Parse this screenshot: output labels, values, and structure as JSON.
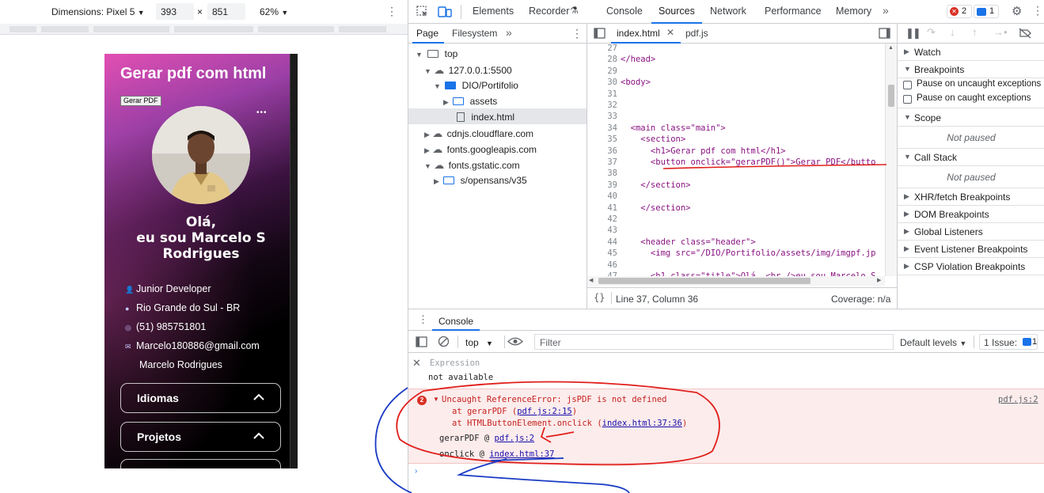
{
  "device_toolbar": {
    "dimensions_label": "Dimensions: Pixel 5",
    "width": "393",
    "times": "×",
    "height": "851",
    "zoom": "62%"
  },
  "phone": {
    "title": "Gerar pdf com html",
    "gerar_button": "Gerar PDF",
    "more": "•••",
    "greeting_line1": "Olá,",
    "greeting_line2": "eu sou Marcelo S",
    "greeting_line3": "Rodrigues",
    "info": [
      {
        "icon": "person-icon",
        "text": "Junior Developer"
      },
      {
        "icon": "location-icon",
        "text": "Rio Grande do Sul - BR"
      },
      {
        "icon": "whatsapp-icon",
        "text": "(51) 985751801"
      },
      {
        "icon": "mail-icon",
        "text": "Marcelo180886@gmail.com"
      },
      {
        "icon": "",
        "text": "Marcelo Rodrigues"
      }
    ],
    "accordions": [
      {
        "label": "Idiomas"
      },
      {
        "label": "Projetos"
      }
    ]
  },
  "devtools": {
    "tabs": [
      "Elements",
      "Recorder",
      "Console",
      "Sources",
      "Network",
      "Performance",
      "Memory"
    ],
    "active_tab": "Sources",
    "error_count": "2",
    "message_count": "1",
    "nav_tabs": [
      "Page",
      "Filesystem"
    ],
    "tree": [
      {
        "label": "top",
        "type": "frame"
      },
      {
        "label": "127.0.0.1:5500",
        "type": "cloud"
      },
      {
        "label": "DIO/Portifolio",
        "type": "folder"
      },
      {
        "label": "assets",
        "type": "folder"
      },
      {
        "label": "index.html",
        "type": "file"
      },
      {
        "label": "cdnjs.cloudflare.com",
        "type": "cloud"
      },
      {
        "label": "fonts.googleapis.com",
        "type": "cloud"
      },
      {
        "label": "fonts.gstatic.com",
        "type": "cloud"
      },
      {
        "label": "s/opensans/v35",
        "type": "folder"
      }
    ],
    "editor_tabs": [
      "index.html",
      "pdf.js"
    ],
    "code_lines": [
      {
        "n": "27",
        "t": ""
      },
      {
        "n": "28",
        "t": "</head>"
      },
      {
        "n": "29",
        "t": ""
      },
      {
        "n": "30",
        "t": "<body>"
      },
      {
        "n": "31",
        "t": ""
      },
      {
        "n": "32",
        "t": ""
      },
      {
        "n": "33",
        "t": ""
      },
      {
        "n": "34",
        "t": "  <main class=\"main\">"
      },
      {
        "n": "35",
        "t": "    <section>"
      },
      {
        "n": "36",
        "t": "      <h1>Gerar pdf com html</h1>"
      },
      {
        "n": "37",
        "t": "      <button onclick=\"gerarPDF()\">Gerar PDF</butto"
      },
      {
        "n": "38",
        "t": ""
      },
      {
        "n": "39",
        "t": "    </section>"
      },
      {
        "n": "40",
        "t": ""
      },
      {
        "n": "41",
        "t": "    </section>"
      },
      {
        "n": "42",
        "t": ""
      },
      {
        "n": "43",
        "t": ""
      },
      {
        "n": "44",
        "t": "    <header class=\"header\">"
      },
      {
        "n": "45",
        "t": "      <img src=\"/DIO/Portifolio/assets/img/imgpf.jp"
      },
      {
        "n": "46",
        "t": ""
      },
      {
        "n": "47",
        "t": "      <h1 class=\"title\">Olá, <br />eu sou Marcelo S"
      }
    ],
    "status_position": "Line 37, Column 36",
    "status_coverage": "Coverage: n/a",
    "right_sections": [
      {
        "label": "Watch",
        "open": false
      },
      {
        "label": "Breakpoints",
        "open": true
      },
      {
        "label": "Scope",
        "open": true
      },
      {
        "label": "Call Stack",
        "open": true
      },
      {
        "label": "XHR/fetch Breakpoints",
        "open": false
      },
      {
        "label": "DOM Breakpoints",
        "open": false
      },
      {
        "label": "Global Listeners",
        "open": false
      },
      {
        "label": "Event Listener Breakpoints",
        "open": false
      },
      {
        "label": "CSP Violation Breakpoints",
        "open": false
      }
    ],
    "pause_uncaught": "Pause on uncaught exceptions",
    "pause_caught": "Pause on caught exceptions",
    "not_paused": "Not paused",
    "console": {
      "tab_label": "Console",
      "context": "top",
      "filter_placeholder": "Filter",
      "levels": "Default levels",
      "issues": "1 Issue:",
      "issues_count": "1",
      "expression_label": "Expression",
      "expression_value": "not available",
      "error_badge": "2",
      "error_message": "Uncaught ReferenceError: jsPDF is not defined",
      "stack1_prefix": "at gerarPDF (",
      "stack1_link": "pdf.js:2:15",
      "stack1_suffix": ")",
      "stack2_prefix": "at HTMLButtonElement.onclick (",
      "stack2_link": "index.html:37:36",
      "stack2_suffix": ")",
      "frame1_name": "gerarPDF @",
      "frame1_link": "pdf.js:2",
      "frame2_name": "onclick  @",
      "frame2_link": "index.html:37",
      "source_link": "pdf.js:2"
    }
  },
  "colors": {
    "accent": "#1a73e8",
    "error": "#d93025",
    "annotation_red": "#e0201c",
    "annotation_blue": "#1a3bc4"
  }
}
